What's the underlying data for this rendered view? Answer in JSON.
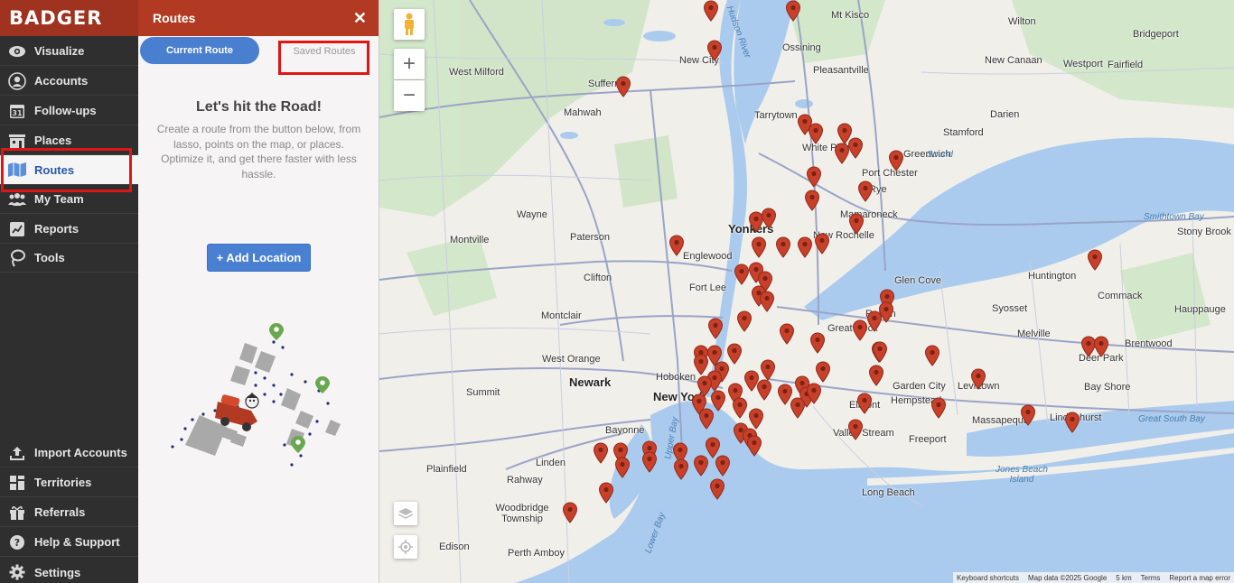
{
  "brand": {
    "name": "BADGER"
  },
  "sidebar": {
    "items": [
      {
        "label": "Visualize",
        "icon": "eye-icon"
      },
      {
        "label": "Accounts",
        "icon": "person-icon"
      },
      {
        "label": "Follow-ups",
        "icon": "calendar-icon",
        "badge": "31"
      },
      {
        "label": "Places",
        "icon": "building-icon"
      },
      {
        "label": "Routes",
        "icon": "map-icon",
        "active": true
      },
      {
        "label": "My Team",
        "icon": "team-icon"
      },
      {
        "label": "Reports",
        "icon": "chart-icon"
      },
      {
        "label": "Tools",
        "icon": "lasso-icon"
      }
    ],
    "bottom_items": [
      {
        "label": "Import Accounts",
        "icon": "upload-icon"
      },
      {
        "label": "Territories",
        "icon": "grid-icon"
      },
      {
        "label": "Referrals",
        "icon": "gift-icon"
      },
      {
        "label": "Help & Support",
        "icon": "help-icon"
      },
      {
        "label": "Settings",
        "icon": "gear-icon"
      }
    ]
  },
  "panel": {
    "title": "Routes",
    "close": "✕",
    "tabs": {
      "current": "Current Route",
      "saved": "Saved Routes"
    },
    "empty_title": "Let's hit the Road!",
    "empty_desc": "Create a route from the button below, from lasso, points on the map, or places. Optimize it, and get there faster with less hassle.",
    "add_button": "+ Add Location"
  },
  "map": {
    "zoom_in": "+",
    "zoom_out": "−",
    "places": [
      "Mt Kisco",
      "Wilton",
      "Bridgeport",
      "New City",
      "Ossining",
      "Pleasantville",
      "New Canaan",
      "Westport",
      "Fairfield",
      "West Milford",
      "Tarrytown",
      "Darien",
      "Mahwah",
      "Stamford",
      "White Plains",
      "Port Chester",
      "Greenwich",
      "Rye",
      "Wayne",
      "Yonkers",
      "Mamaroneck",
      "Montville",
      "Paterson",
      "Englewood",
      "New Rochelle",
      "Smithtown Bay",
      "Stony Brook",
      "Huntington",
      "Glen Cove",
      "Clifton",
      "Fort Lee",
      "Commack",
      "Hauppauge",
      "Montclair",
      "Roslyn",
      "Syosset",
      "Melville",
      "Brentwood",
      "West Orange",
      "Deer Park",
      "Newark",
      "Hoboken",
      "New York",
      "Garden City",
      "Levittown",
      "Bay Shore",
      "Summit",
      "Hempstead",
      "Elmont",
      "Massapequa",
      "Lindenhurst",
      "Great South Bay",
      "Bayonne",
      "Valley Stream",
      "Freeport",
      "Linden",
      "Plainfield",
      "Rahway",
      "Jones Beach Island",
      "Long Beach",
      "Woodbridge Township",
      "Lower Bay",
      "Perth Amboy",
      "Edison",
      "Suffern",
      "Great Neck",
      "Hudson River",
      "Upper Bay",
      "Sound"
    ],
    "attribution": [
      "Keyboard shortcuts",
      "Map data ©2025 Google",
      "5 km",
      "Terms",
      "Report a map error"
    ]
  }
}
